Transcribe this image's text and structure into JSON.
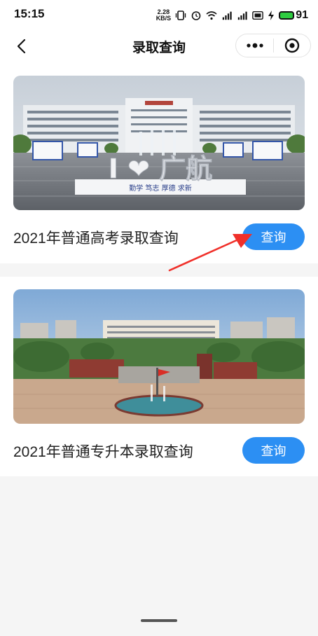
{
  "status_bar": {
    "time": "15:15",
    "net_speed_value": "2.28",
    "net_speed_unit": "KB/S",
    "battery": "91",
    "icons": [
      "vibrate-icon",
      "alarm-icon",
      "wifi-icon",
      "signal-4g-icon",
      "signal-4g-icon",
      "hd-icon",
      "charging-icon",
      "battery-icon"
    ]
  },
  "nav": {
    "title": "录取查询",
    "back_icon": "chevron-left-icon",
    "more_icon": "more-dots-icon",
    "close_icon": "target-circle-icon"
  },
  "cards": [
    {
      "title": "2021年普通高考录取查询",
      "button_label": "查询",
      "photo_text": "I ❤ 广航",
      "photo_banner": "勤学  笃志  厚德  求新"
    },
    {
      "title": "2021年普通专升本录取查询",
      "button_label": "查询"
    }
  ],
  "colors": {
    "accent": "#2c8ff3",
    "arrow": "#f0302a",
    "background": "#f5f5f5"
  }
}
